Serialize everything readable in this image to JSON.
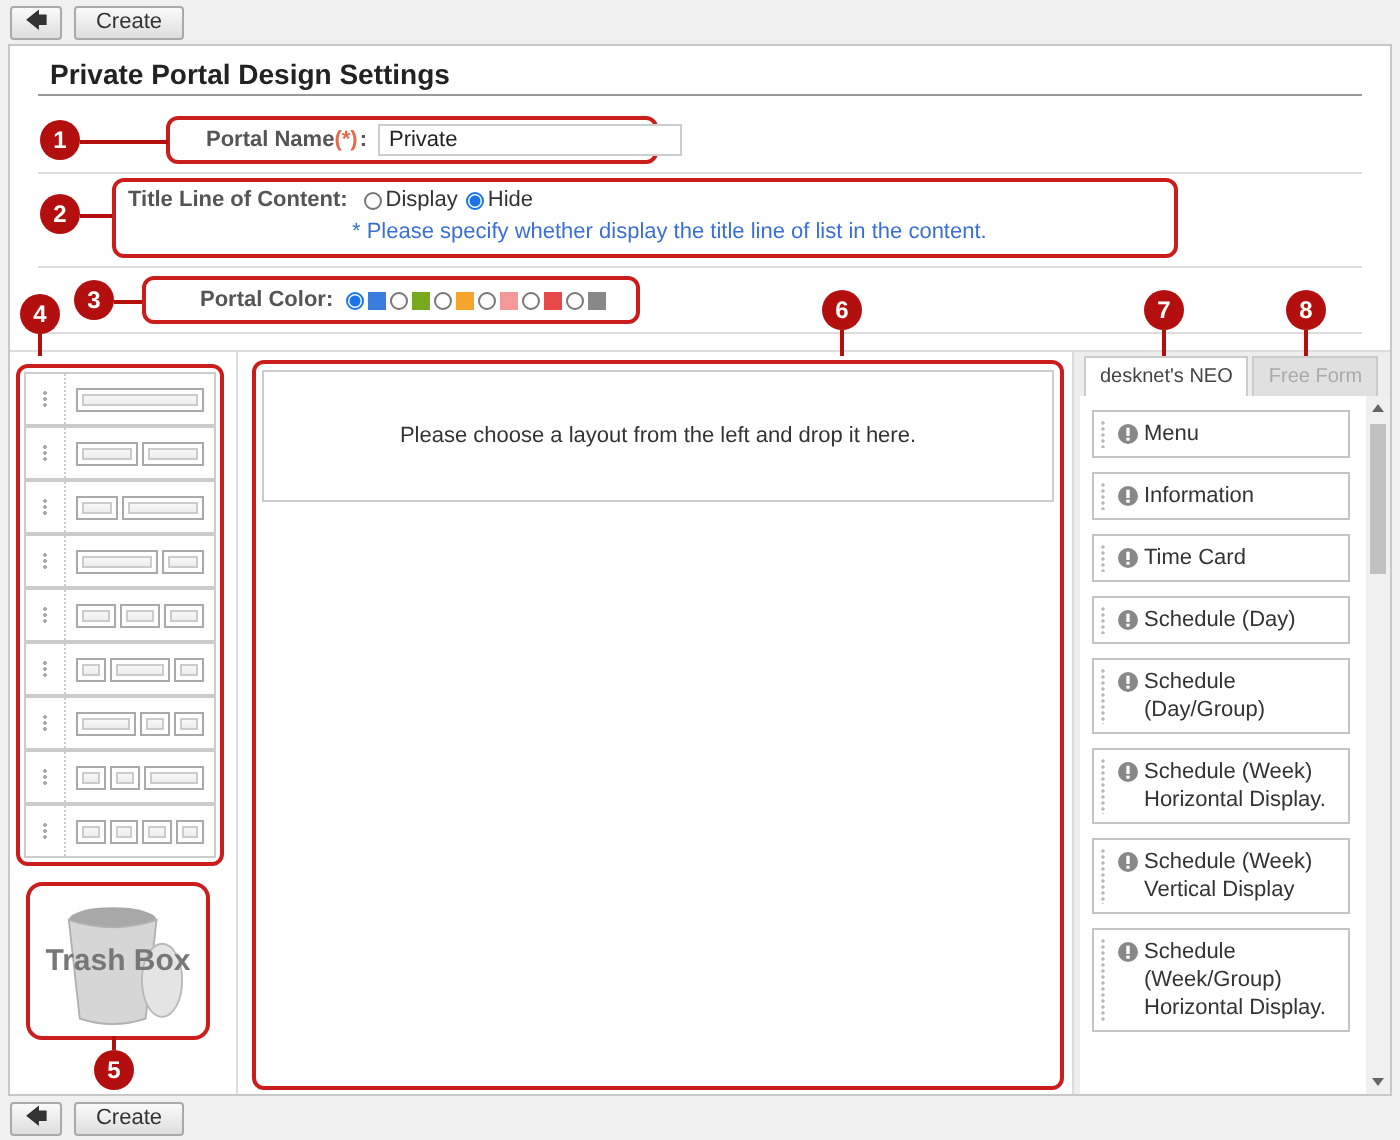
{
  "toolbar_top": {
    "back_button": "🡄",
    "create_button": "Create"
  },
  "title": "Private Portal Design Settings",
  "portal_name": {
    "label": "Portal Name",
    "required_mark": "(*)",
    "colon": ":",
    "value": "Private"
  },
  "title_line": {
    "label": "Title Line of Content:",
    "options": [
      {
        "label": "Display",
        "selected": false
      },
      {
        "label": "Hide",
        "selected": true
      }
    ],
    "note": "* Please specify whether display the title line of list in the content."
  },
  "portal_color": {
    "label": "Portal Color:",
    "options": [
      {
        "color": "#3b7ddd",
        "selected": true
      },
      {
        "color": "#77aa1c",
        "selected": false
      },
      {
        "color": "#f5a52b",
        "selected": false
      },
      {
        "color": "#f59898",
        "selected": false
      },
      {
        "color": "#e84848",
        "selected": false
      },
      {
        "color": "#888888",
        "selected": false
      }
    ]
  },
  "layouts": [
    {
      "kind": "one"
    },
    {
      "kind": "two-equal"
    },
    {
      "kind": "narrow-wide"
    },
    {
      "kind": "wide-narrow"
    },
    {
      "kind": "three-equal"
    },
    {
      "kind": "narrow-wide-narrow"
    },
    {
      "kind": "wide-narrow-narrow"
    },
    {
      "kind": "narrow-narrow-wide"
    },
    {
      "kind": "four-equal"
    }
  ],
  "trash_box": "Trash Box",
  "drop_area": {
    "hint": "Please choose a layout from the left and drop it here."
  },
  "tabs": [
    {
      "label": "desknet's NEO",
      "selected": true
    },
    {
      "label": "Free Form",
      "selected": false
    }
  ],
  "widgets": [
    {
      "label": "Menu"
    },
    {
      "label": "Information"
    },
    {
      "label": "Time Card"
    },
    {
      "label": "Schedule (Day)"
    },
    {
      "label": "Schedule (Day/Group)"
    },
    {
      "label": "Schedule (Week) Horizontal Display."
    },
    {
      "label": "Schedule (Week) Vertical Display"
    },
    {
      "label": "Schedule (Week/Group) Horizontal Display."
    }
  ],
  "callouts": [
    {
      "number": "1"
    },
    {
      "number": "2"
    },
    {
      "number": "3"
    },
    {
      "number": "4"
    },
    {
      "number": "5"
    },
    {
      "number": "6"
    },
    {
      "number": "7"
    },
    {
      "number": "8"
    }
  ],
  "toolbar_bottom": {
    "back_button": "🡄",
    "create_button": "Create"
  }
}
